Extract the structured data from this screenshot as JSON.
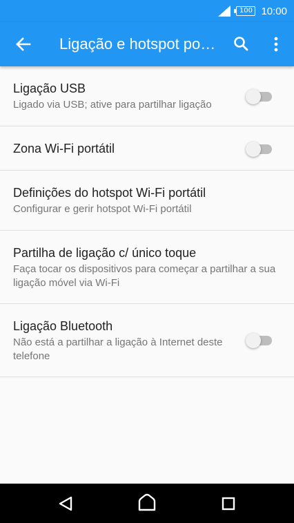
{
  "status_bar": {
    "time": "10:00",
    "battery": "100",
    "signal_icon": "signal-icon",
    "battery_icon": "battery-icon"
  },
  "app_bar": {
    "title": "Ligação e hotspot portátil",
    "back_icon": "arrow-back-icon",
    "search_icon": "search-icon",
    "more_icon": "more-vert-icon",
    "color": "#2196f3"
  },
  "settings": [
    {
      "title": "Ligação USB",
      "subtitle": "Ligado via USB; ative para partilhar ligação",
      "toggle": false
    },
    {
      "title": "Zona Wi-Fi portátil",
      "subtitle": "",
      "toggle": false
    },
    {
      "title": "Definições do hotspot Wi-Fi portátil",
      "subtitle": "Configurar e gerir hotspot Wi-Fi portátil"
    },
    {
      "title": "Partilha de ligação c/ único toque",
      "subtitle": "Faça tocar os dispositivos para começar a partilhar a sua ligação móvel via Wi-Fi"
    },
    {
      "title": "Ligação Bluetooth",
      "subtitle": "Não está a partilhar a ligação à Internet deste telefone",
      "toggle": false
    }
  ],
  "nav_bar": {
    "back_icon": "nav-back-icon",
    "home_icon": "nav-home-icon",
    "recents_icon": "nav-recents-icon"
  }
}
